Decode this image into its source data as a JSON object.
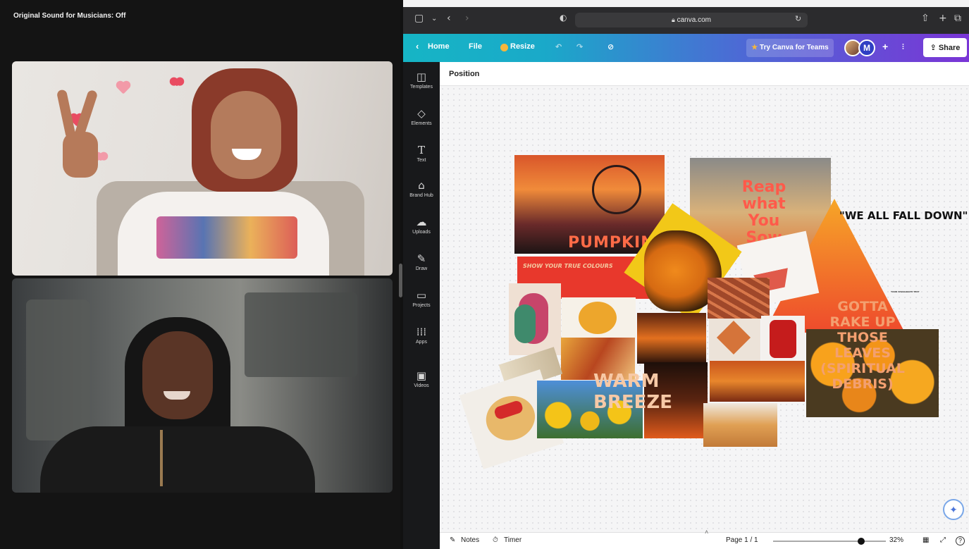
{
  "call": {
    "sound_label": "Original Sound for Musicians: Off"
  },
  "browser": {
    "url": "canva.com"
  },
  "canva_toolbar": {
    "home": "Home",
    "file": "File",
    "resize": "Resize",
    "try_teams": "Try Canva for Teams",
    "avatar_initial": "M",
    "share": "Share"
  },
  "side_rail": [
    {
      "label": "Templates",
      "icon": "templates-icon"
    },
    {
      "label": "Elements",
      "icon": "elements-icon"
    },
    {
      "label": "Text",
      "icon": "text-icon"
    },
    {
      "label": "Brand Hub",
      "icon": "brand-hub-icon"
    },
    {
      "label": "Uploads",
      "icon": "uploads-icon"
    },
    {
      "label": "Draw",
      "icon": "draw-icon"
    },
    {
      "label": "Projects",
      "icon": "folder-icon"
    },
    {
      "label": "Apps",
      "icon": "apps-icon"
    },
    {
      "label": "Videos",
      "icon": "videos-icon"
    }
  ],
  "props_bar": {
    "position": "Position"
  },
  "collage": {
    "pumpkin": "PUMPKIN",
    "true_colours": "SHOW YOUR TRUE COLOURS",
    "reap": [
      "Reap",
      "what",
      "You",
      "Sow"
    ],
    "we_all_fall_down": "\"WE ALL FALL DOWN\"",
    "gotta": [
      "GOTTA",
      "RAKE UP",
      "THOSE",
      "LEAVES",
      "(SPIRITUAL",
      "DEBRIS)"
    ],
    "warm_breeze": [
      "WARM",
      "BREEZE"
    ],
    "small_text": "YOUR PARAGRAPH TEXT"
  },
  "bottom_bar": {
    "notes": "Notes",
    "timer": "Timer",
    "page": "Page 1 / 1",
    "zoom": "32%",
    "zoom_fraction": 0.32
  },
  "colors": {
    "canva_gradient_start": "#16b5c5",
    "canva_gradient_end": "#7a35d6",
    "rail_bg": "#18191b"
  }
}
